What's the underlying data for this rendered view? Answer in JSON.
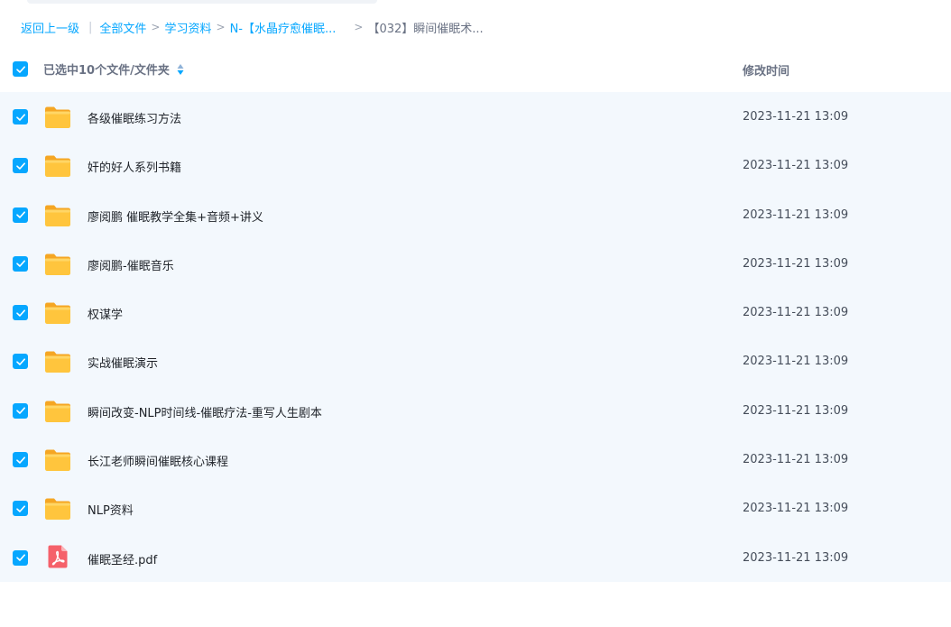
{
  "breadcrumb": {
    "back": "返回上一级",
    "items": [
      "全部文件",
      "学习资料",
      "N-【水晶疗愈催眠..."
    ],
    "current": "【032】瞬间催眠术..."
  },
  "header": {
    "selected_label": "已选中10个文件/文件夹",
    "modified_label": "修改时间"
  },
  "colors": {
    "accent": "#06a7ff",
    "folder": "#ffc53d",
    "pdf": "#f5616a"
  },
  "files": [
    {
      "name": "各级催眠练习方法",
      "time": "2023-11-21 13:09",
      "type": "folder",
      "checked": true
    },
    {
      "name": "奸的好人系列书籍",
      "time": "2023-11-21 13:09",
      "type": "folder",
      "checked": true
    },
    {
      "name": "廖阅鹏 催眠教学全集+音频+讲义",
      "time": "2023-11-21 13:09",
      "type": "folder",
      "checked": true
    },
    {
      "name": "廖阅鹏-催眠音乐",
      "time": "2023-11-21 13:09",
      "type": "folder",
      "checked": true
    },
    {
      "name": "权谋学",
      "time": "2023-11-21 13:09",
      "type": "folder",
      "checked": true
    },
    {
      "name": "实战催眠演示",
      "time": "2023-11-21 13:09",
      "type": "folder",
      "checked": true
    },
    {
      "name": "瞬间改变-NLP时间线-催眠疗法-重写人生剧本",
      "time": "2023-11-21 13:09",
      "type": "folder",
      "checked": true
    },
    {
      "name": "长江老师瞬间催眠核心课程",
      "time": "2023-11-21 13:09",
      "type": "folder",
      "checked": true
    },
    {
      "name": "NLP资料",
      "time": "2023-11-21 13:09",
      "type": "folder",
      "checked": true
    },
    {
      "name": "催眠圣经.pdf",
      "time": "2023-11-21 13:09",
      "type": "pdf",
      "checked": true
    }
  ]
}
